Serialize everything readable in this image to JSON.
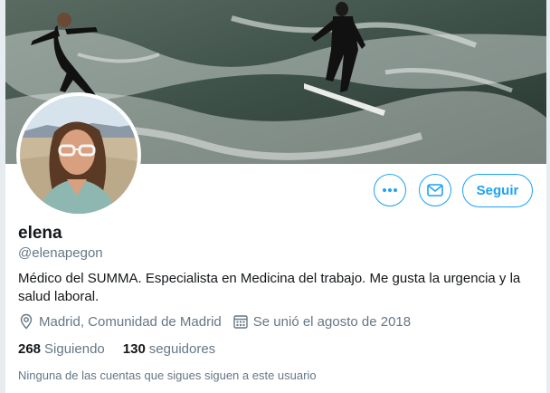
{
  "profile": {
    "name": "elena",
    "handle": "@elenapegon",
    "bio": "Médico del SUMMA. Especialista en Medicina del trabajo. Me gusta la urgencia y la salud laboral.",
    "location": "Madrid, Comunidad de Madrid",
    "joined": "Se unió el agosto de 2018"
  },
  "actions": {
    "follow_label": "Seguir",
    "more_icon": "more-icon",
    "message_icon": "envelope-icon"
  },
  "stats": {
    "following_count": "268",
    "following_label": "Siguiendo",
    "followers_count": "130",
    "followers_label": "seguidores"
  },
  "note": "Ninguna de las cuentas que sigues siguen a este usuario",
  "colors": {
    "accent": "#1da1f2",
    "secondary_text": "#657786",
    "primary_text": "#14171a"
  }
}
